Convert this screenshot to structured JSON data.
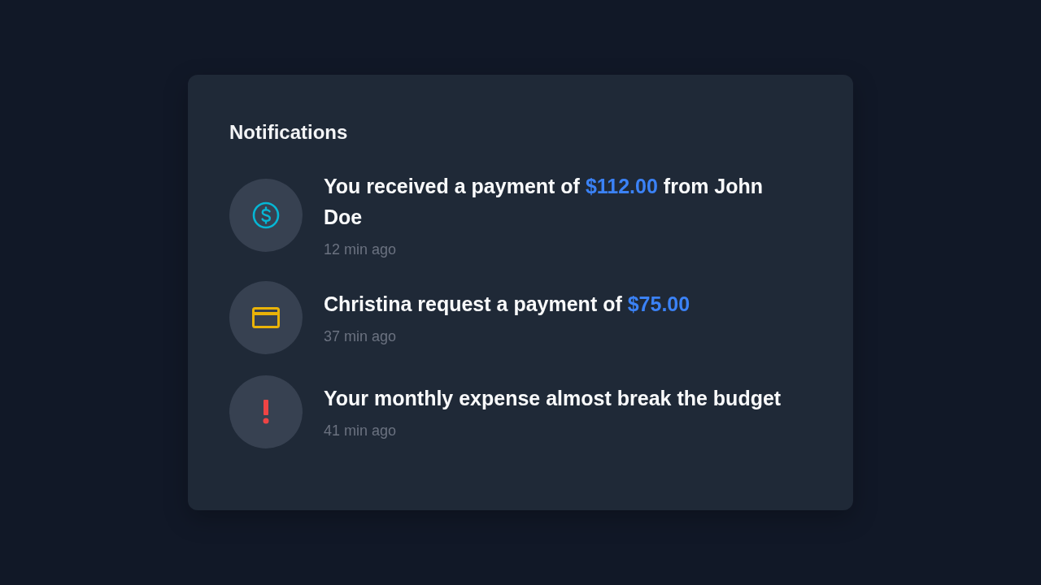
{
  "title": "Notifications",
  "notifications": [
    {
      "kind": "payment",
      "color": "#06b6d4",
      "message": [
        {
          "kind": "text",
          "text": "You received a payment of "
        },
        {
          "kind": "amount",
          "text": "$112.00"
        },
        {
          "kind": "text",
          "text": " from John Doe"
        }
      ],
      "time": "12 min ago"
    },
    {
      "kind": "card",
      "color": "#eab308",
      "message": [
        {
          "kind": "text",
          "text": "Christina request a payment of "
        },
        {
          "kind": "amount",
          "text": "$75.00"
        }
      ],
      "time": "37 min ago"
    },
    {
      "kind": "alert",
      "color": "#ef4444",
      "message": [
        {
          "kind": "text",
          "text": "Your monthly expense almost break the budget"
        }
      ],
      "time": "41 min ago"
    }
  ]
}
